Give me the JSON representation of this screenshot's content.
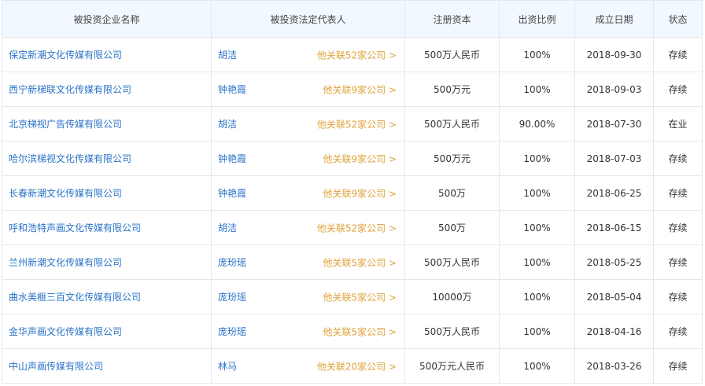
{
  "headers": {
    "company": "被投资企业名称",
    "rep": "被投资法定代表人",
    "capital": "注册资本",
    "ratio": "出资比例",
    "date": "成立日期",
    "status": "状态"
  },
  "rows": [
    {
      "company": "保定新潮文化传媒有限公司",
      "rep": "胡洁",
      "related": "他关联52家公司 >",
      "capital": "500万人民币",
      "ratio": "100%",
      "date": "2018-09-30",
      "status": "存续"
    },
    {
      "company": "西宁新梯联文化传媒有限公司",
      "rep": "钟艳霞",
      "related": "他关联9家公司 >",
      "capital": "500万元",
      "ratio": "100%",
      "date": "2018-09-03",
      "status": "存续"
    },
    {
      "company": "北京梯视广告传媒有限公司",
      "rep": "胡洁",
      "related": "他关联52家公司 >",
      "capital": "500万人民币",
      "ratio": "90.00%",
      "date": "2018-07-30",
      "status": "在业"
    },
    {
      "company": "哈尔滨梯视文化传媒有限公司",
      "rep": "钟艳霞",
      "related": "他关联9家公司 >",
      "capital": "500万元",
      "ratio": "100%",
      "date": "2018-07-03",
      "status": "存续"
    },
    {
      "company": "长春新潮文化传媒有限公司",
      "rep": "钟艳霞",
      "related": "他关联9家公司 >",
      "capital": "500万",
      "ratio": "100%",
      "date": "2018-06-25",
      "status": "存续"
    },
    {
      "company": "呼和浩特声画文化传媒有限公司",
      "rep": "胡洁",
      "related": "他关联52家公司 >",
      "capital": "500万",
      "ratio": "100%",
      "date": "2018-06-15",
      "status": "存续"
    },
    {
      "company": "兰州新潮文化传媒有限公司",
      "rep": "庞玢瑶",
      "related": "他关联5家公司 >",
      "capital": "500万人民币",
      "ratio": "100%",
      "date": "2018-05-25",
      "status": "存续"
    },
    {
      "company": "曲水美榧三百文化传媒有限公司",
      "rep": "庞玢瑶",
      "related": "他关联5家公司 >",
      "capital": "10000万",
      "ratio": "100%",
      "date": "2018-05-04",
      "status": "存续"
    },
    {
      "company": "金华声画文化传媒有限公司",
      "rep": "庞玢瑶",
      "related": "他关联5家公司 >",
      "capital": "500万人民币",
      "ratio": "100%",
      "date": "2018-04-16",
      "status": "存续"
    },
    {
      "company": "中山声画传媒有限公司",
      "rep": "林马",
      "related": "他关联20家公司 >",
      "capital": "500万元人民币",
      "ratio": "100%",
      "date": "2018-03-26",
      "status": "存续"
    }
  ],
  "colors": {
    "link": "#2a73c7",
    "related": "#e0a23a",
    "status": "#2bb47a",
    "header_bg": "#f2f8ff"
  }
}
